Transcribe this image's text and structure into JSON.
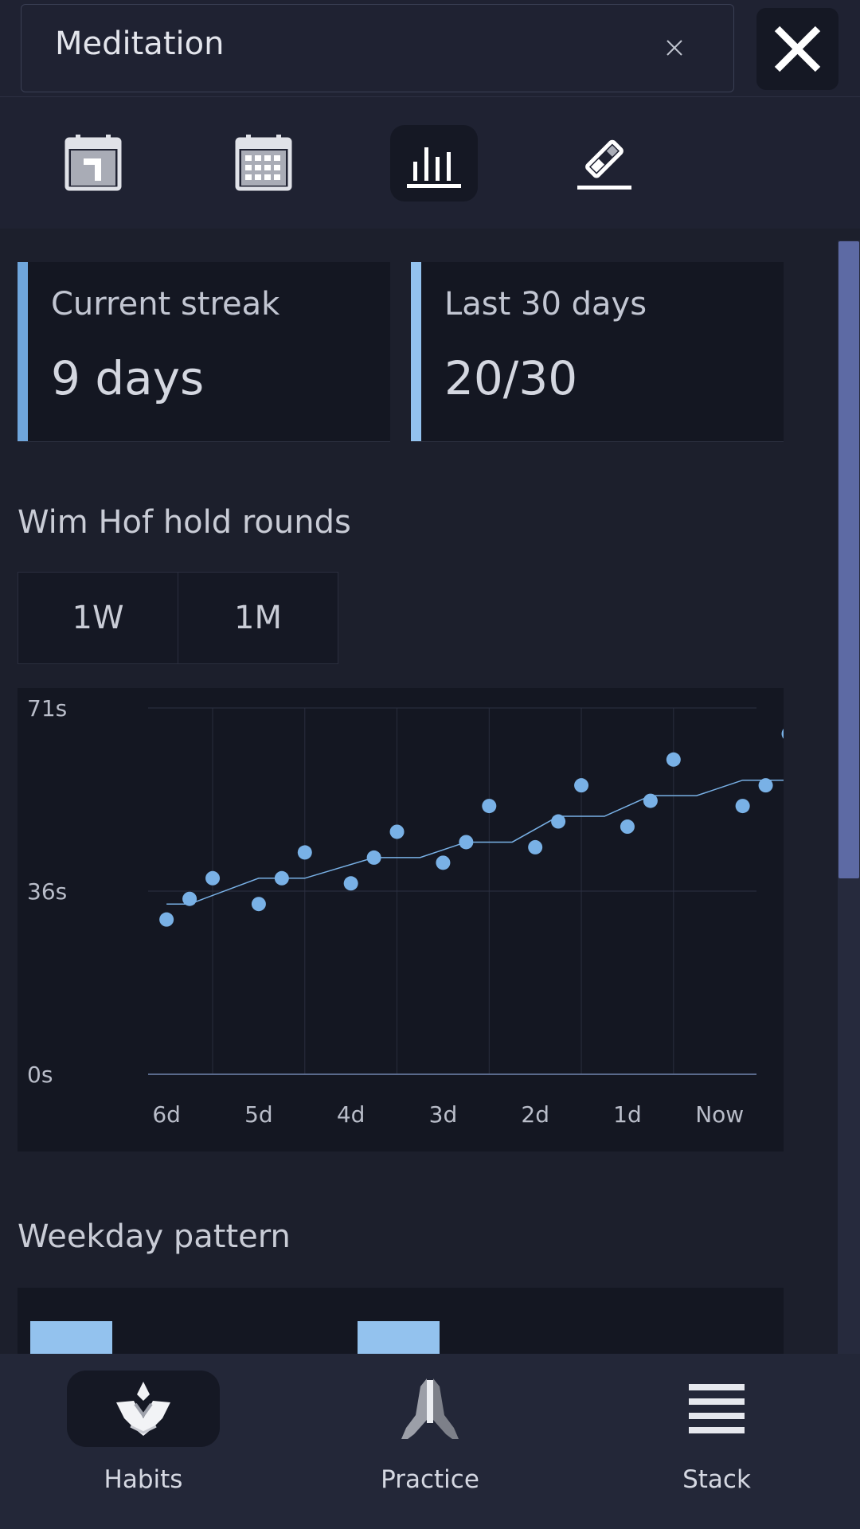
{
  "header": {
    "title": "Meditation",
    "clear_icon": "clear-x-icon",
    "close_icon": "close-x-icon"
  },
  "tabs": [
    {
      "name": "day-calendar-icon",
      "active": false
    },
    {
      "name": "month-calendar-icon",
      "active": false
    },
    {
      "name": "stats-chart-icon",
      "active": true
    },
    {
      "name": "edit-pencil-icon",
      "active": false
    }
  ],
  "stats": {
    "streak": {
      "label": "Current streak",
      "value": "9 days"
    },
    "last30": {
      "label": "Last 30 days",
      "value": "20/30"
    }
  },
  "chart_section": {
    "title": "Wim Hof hold rounds",
    "ranges": [
      "1W",
      "1M"
    ]
  },
  "chart_data": {
    "type": "scatter",
    "title": "Wim Hof hold rounds",
    "y_unit": "s",
    "ylim": [
      0,
      71
    ],
    "y_ticks": [
      "0s",
      "36s",
      "71s"
    ],
    "x_ticks": [
      "6d",
      "5d",
      "4d",
      "3d",
      "2d",
      "1d",
      "Now"
    ],
    "x_range_days": [
      -6.2,
      0.4
    ],
    "points": [
      {
        "x": -6.0,
        "y": 30
      },
      {
        "x": -5.75,
        "y": 34
      },
      {
        "x": -5.5,
        "y": 38
      },
      {
        "x": -5.0,
        "y": 33
      },
      {
        "x": -4.75,
        "y": 38
      },
      {
        "x": -4.5,
        "y": 43
      },
      {
        "x": -4.0,
        "y": 37
      },
      {
        "x": -3.75,
        "y": 42
      },
      {
        "x": -3.5,
        "y": 47
      },
      {
        "x": -3.0,
        "y": 41
      },
      {
        "x": -2.75,
        "y": 45
      },
      {
        "x": -2.5,
        "y": 52
      },
      {
        "x": -2.0,
        "y": 44
      },
      {
        "x": -1.75,
        "y": 49
      },
      {
        "x": -1.5,
        "y": 56
      },
      {
        "x": -1.0,
        "y": 48
      },
      {
        "x": -0.75,
        "y": 53
      },
      {
        "x": -0.5,
        "y": 61
      },
      {
        "x": 0.25,
        "y": 52
      },
      {
        "x": 0.5,
        "y": 56
      },
      {
        "x": 0.75,
        "y": 66
      }
    ],
    "trend": [
      {
        "x": -6.0,
        "y": 33
      },
      {
        "x": -5.75,
        "y": 33
      },
      {
        "x": -5.0,
        "y": 38
      },
      {
        "x": -4.5,
        "y": 38
      },
      {
        "x": -3.75,
        "y": 42
      },
      {
        "x": -3.25,
        "y": 42
      },
      {
        "x": -2.75,
        "y": 45
      },
      {
        "x": -2.25,
        "y": 45
      },
      {
        "x": -1.75,
        "y": 50
      },
      {
        "x": -1.25,
        "y": 50
      },
      {
        "x": -0.75,
        "y": 54
      },
      {
        "x": -0.25,
        "y": 54
      },
      {
        "x": 0.25,
        "y": 57
      },
      {
        "x": 0.75,
        "y": 57
      }
    ],
    "grid": true,
    "color": "#79b1e6"
  },
  "weekday_section": {
    "title": "Weekday pattern",
    "bar_levels": [
      0.6,
      0.6
    ],
    "color": "#93c2ee"
  },
  "bottom_nav": [
    {
      "label": "Habits",
      "icon": "lotus-icon",
      "active": true
    },
    {
      "label": "Practice",
      "icon": "praying-hands-icon",
      "active": false
    },
    {
      "label": "Stack",
      "icon": "menu-lines-icon",
      "active": false
    }
  ]
}
